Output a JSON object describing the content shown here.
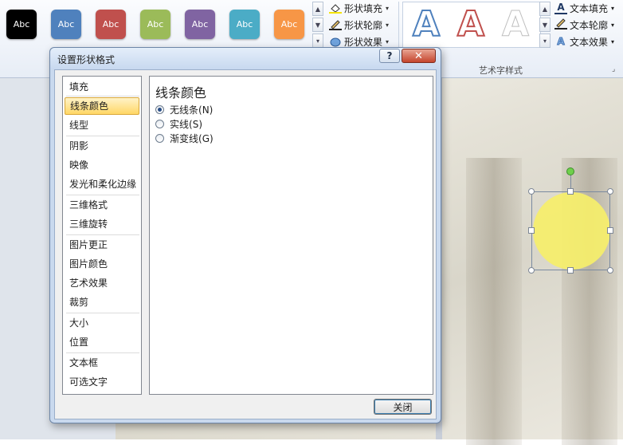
{
  "ribbon": {
    "shape_styles": [
      {
        "label": "Abc",
        "color": "#000000"
      },
      {
        "label": "Abc",
        "color": "#4f81bd"
      },
      {
        "label": "Abc",
        "color": "#c0504d"
      },
      {
        "label": "Abc",
        "color": "#9bbb59"
      },
      {
        "label": "Abc",
        "color": "#8064a2"
      },
      {
        "label": "Abc",
        "color": "#4bacc6"
      },
      {
        "label": "Abc",
        "color": "#f79646"
      }
    ],
    "shape_commands": {
      "fill": "形状填充",
      "outline": "形状轮廓",
      "effects": "形状效果"
    },
    "wordart_letters": [
      {
        "letter": "A",
        "color": "#4f81bd"
      },
      {
        "letter": "A",
        "color": "#c0504d"
      },
      {
        "letter": "A",
        "color": "#ffffff"
      }
    ],
    "text_commands": {
      "fill": "文本填充",
      "outline": "文本轮廓",
      "effects": "文本效果"
    },
    "wordart_group_label": "艺术字样式"
  },
  "dialog": {
    "title": "设置形状格式",
    "help_label": "?",
    "close_x_label": "✕",
    "categories": [
      "填充",
      "线条颜色",
      "线型",
      "阴影",
      "映像",
      "发光和柔化边缘",
      "三维格式",
      "三维旋转",
      "图片更正",
      "图片颜色",
      "艺术效果",
      "裁剪",
      "大小",
      "位置",
      "文本框",
      "可选文字"
    ],
    "selected_category": "线条颜色",
    "panel_heading": "线条颜色",
    "options": [
      {
        "label": "无线条",
        "shortcut": "(N)",
        "selected": true
      },
      {
        "label": "实线",
        "shortcut": "(S)",
        "selected": false
      },
      {
        "label": "渐变线",
        "shortcut": "(G)",
        "selected": false
      }
    ],
    "close_button_label": "关闭"
  },
  "slide": {
    "circle_color": "#f6ef6a"
  }
}
